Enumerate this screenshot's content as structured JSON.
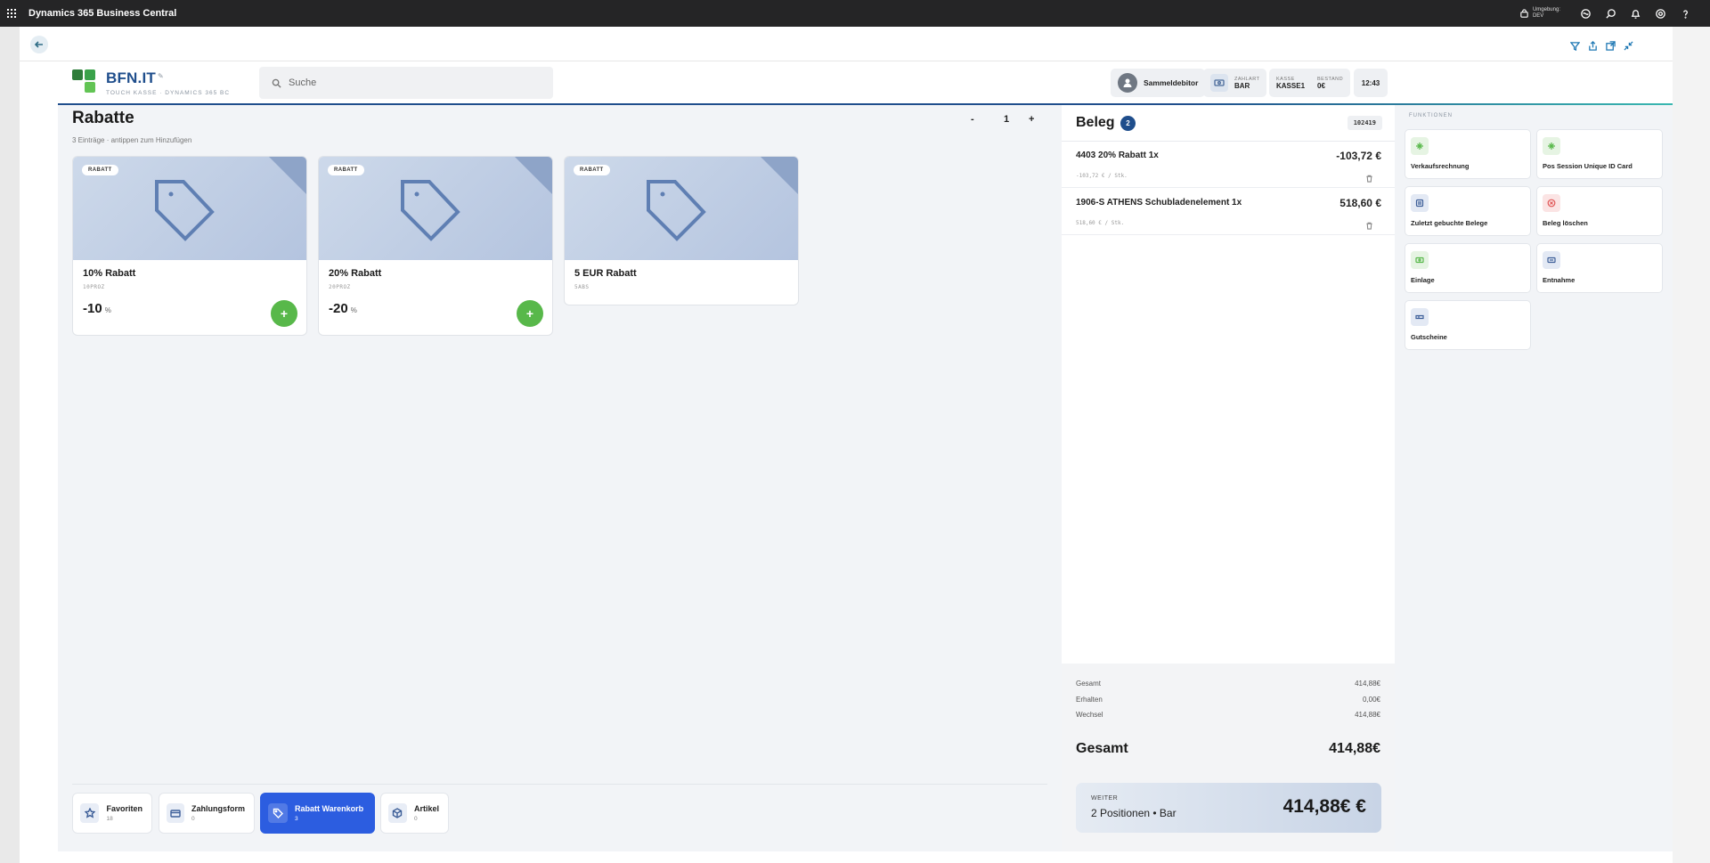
{
  "topbar": {
    "app_title": "Dynamics 365 Business Central",
    "env_label": "Umgebung:",
    "env_value": "DEV"
  },
  "header": {
    "brand": "BFN.IT",
    "brand_sub": "TOUCH KASSE · DYNAMICS 365 BC",
    "search_placeholder": "Suche",
    "customer": "Sammeldebitor",
    "zahlart_label": "ZAHLART",
    "zahlart_value": "BAR",
    "kasse_label": "KASSE",
    "kasse_value": "KASSE1",
    "bestand_label": "BESTAND",
    "bestand_value": "0€",
    "time": "12:43"
  },
  "left": {
    "title": "Rabatte",
    "subtitle": "3 Einträge · antippen zum Hinzufügen",
    "qty_minus": "-",
    "qty_value": "1",
    "qty_plus": "+",
    "cards": [
      {
        "badge": "RABATT",
        "name": "10% Rabatt",
        "code": "10PROZ",
        "value": "-10",
        "unit": "%"
      },
      {
        "badge": "RABATT",
        "name": "20% Rabatt",
        "code": "20PROZ",
        "value": "-20",
        "unit": "%"
      },
      {
        "badge": "RABATT",
        "name": "5 EUR Rabatt",
        "code": "5ABS"
      }
    ],
    "tabs": [
      {
        "label": "Favoriten",
        "count": "18",
        "icon": "star-icon"
      },
      {
        "label": "Zahlungsform",
        "count": "0",
        "icon": "card-icon"
      },
      {
        "label": "Rabatt Warenkorb",
        "count": "3",
        "icon": "tag-icon"
      },
      {
        "label": "Artikel",
        "count": "0",
        "icon": "box-icon"
      }
    ]
  },
  "beleg": {
    "title": "Beleg",
    "count": "2",
    "number": "102419",
    "items": [
      {
        "name": "4403 20% Rabatt 1x",
        "price": "-103,72 €",
        "detail": "-103,72 € / Stk."
      },
      {
        "name": "1906-S ATHENS Schubladenelement 1x",
        "price": "518,60 €",
        "detail": "518,60 € / Stk."
      }
    ],
    "gesamt_label": "Gesamt",
    "gesamt_value": "414,88€",
    "erhalten_label": "Erhalten",
    "erhalten_value": "0,00€",
    "wechsel_label": "Wechsel",
    "wechsel_value": "414,88€",
    "grand_label": "Gesamt",
    "grand_value": "414,88€",
    "weiter_label": "WEITER",
    "weiter_summary": "2 Positionen • Bar",
    "weiter_amount": "414,88€ €"
  },
  "funktionen": {
    "title": "FUNKTIONEN",
    "buttons": [
      {
        "label": "Verkaufsrechnung",
        "icon": "sparkle-icon",
        "color": "#58b84a"
      },
      {
        "label": "Pos Session Unique ID Card",
        "icon": "sparkle-icon",
        "color": "#58b84a"
      },
      {
        "label": "Zuletzt gebuchte Belege",
        "icon": "receipt-icon",
        "color": "#3c5e98"
      },
      {
        "label": "Beleg löschen",
        "icon": "delete-circle-icon",
        "color": "#e05555"
      },
      {
        "label": "Einlage",
        "icon": "cash-in-icon",
        "color": "#58b84a"
      },
      {
        "label": "Entnahme",
        "icon": "cash-out-icon",
        "color": "#3c5e98"
      },
      {
        "label": "Gutscheine",
        "icon": "voucher-icon",
        "color": "#3c5e98"
      }
    ]
  },
  "colors": {
    "brand": "#1f4e8c",
    "accent_green": "#58b84a",
    "active_tab": "#2c5de0"
  }
}
